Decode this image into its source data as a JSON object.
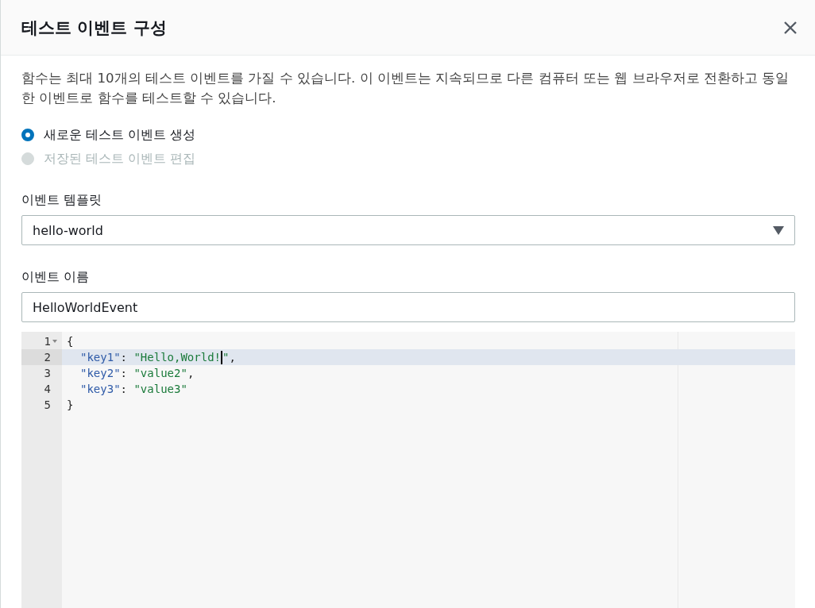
{
  "dialog": {
    "title": "테스트 이벤트 구성"
  },
  "description": "함수는 최대 10개의 테스트 이벤트를 가질 수 있습니다. 이 이벤트는 지속되므로 다른 컴퓨터 또는 웹 브라우저로 전환하고 동일한 이벤트로 함수를 테스트할 수 있습니다.",
  "options": [
    {
      "label": "새로운 테스트 이벤트 생성",
      "selected": true,
      "disabled": false
    },
    {
      "label": "저장된 테스트 이벤트 편집",
      "selected": false,
      "disabled": true
    }
  ],
  "template": {
    "label": "이벤트 템플릿",
    "value": "hello-world"
  },
  "event_name": {
    "label": "이벤트 이름",
    "value": "HelloWorldEvent"
  },
  "editor": {
    "lines": [
      {
        "number": "1",
        "foldable": true,
        "active": false,
        "indented": false,
        "tokens": [
          {
            "kind": "punct",
            "text": "{"
          }
        ]
      },
      {
        "number": "2",
        "foldable": false,
        "active": true,
        "indented": true,
        "tokens": [
          {
            "kind": "key",
            "text": "\"key1\""
          },
          {
            "kind": "punct",
            "text": ": "
          },
          {
            "kind": "string",
            "text": "\"Hello,World!"
          },
          {
            "kind": "cursor"
          },
          {
            "kind": "string",
            "text": "\""
          },
          {
            "kind": "punct",
            "text": ","
          }
        ]
      },
      {
        "number": "3",
        "foldable": false,
        "active": false,
        "indented": true,
        "tokens": [
          {
            "kind": "key",
            "text": "\"key2\""
          },
          {
            "kind": "punct",
            "text": ": "
          },
          {
            "kind": "string",
            "text": "\"value2\""
          },
          {
            "kind": "punct",
            "text": ","
          }
        ]
      },
      {
        "number": "4",
        "foldable": false,
        "active": false,
        "indented": true,
        "tokens": [
          {
            "kind": "key",
            "text": "\"key3\""
          },
          {
            "kind": "punct",
            "text": ": "
          },
          {
            "kind": "string",
            "text": "\"value3\""
          }
        ]
      },
      {
        "number": "5",
        "foldable": false,
        "active": false,
        "indented": false,
        "tokens": [
          {
            "kind": "punct",
            "text": "}"
          }
        ]
      }
    ]
  }
}
